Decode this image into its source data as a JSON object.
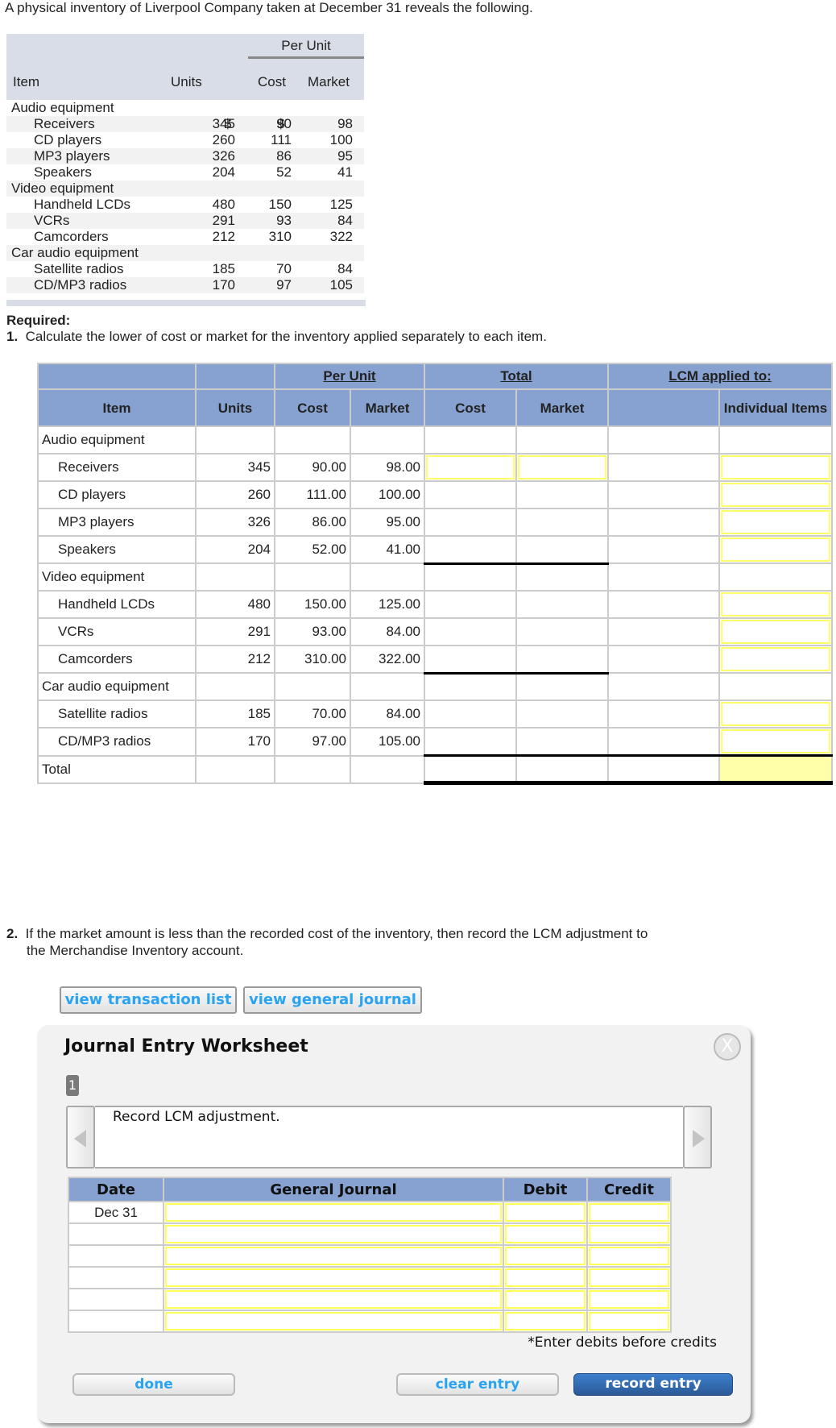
{
  "intro": "A physical inventory of Liverpool Company taken at December 31 reveals the following.",
  "source_table": {
    "group_header": "Per Unit",
    "headers": {
      "item": "Item",
      "units": "Units",
      "cost": "Cost",
      "market": "Market"
    },
    "rows": [
      {
        "type": "group",
        "item": "Audio equipment"
      },
      {
        "type": "item",
        "item": "Receivers",
        "units": "345",
        "cost": "90",
        "market": "98",
        "dollar": "$"
      },
      {
        "type": "item",
        "item": "CD players",
        "units": "260",
        "cost": "111",
        "market": "100"
      },
      {
        "type": "item",
        "item": "MP3 players",
        "units": "326",
        "cost": "86",
        "market": "95"
      },
      {
        "type": "item",
        "item": "Speakers",
        "units": "204",
        "cost": "52",
        "market": "41"
      },
      {
        "type": "group",
        "item": "Video equipment"
      },
      {
        "type": "item",
        "item": "Handheld LCDs",
        "units": "480",
        "cost": "150",
        "market": "125"
      },
      {
        "type": "item",
        "item": "VCRs",
        "units": "291",
        "cost": "93",
        "market": "84"
      },
      {
        "type": "item",
        "item": "Camcorders",
        "units": "212",
        "cost": "310",
        "market": "322"
      },
      {
        "type": "group",
        "item": "Car audio equipment"
      },
      {
        "type": "item",
        "item": "Satellite radios",
        "units": "185",
        "cost": "70",
        "market": "84"
      },
      {
        "type": "item",
        "item": "CD/MP3 radios",
        "units": "170",
        "cost": "97",
        "market": "105"
      }
    ]
  },
  "required": {
    "title": "Required:",
    "q1_num": "1.",
    "q1_text": "Calculate the lower of cost or market for the inventory applied separately to each item.",
    "q2_num": "2.",
    "q2_line1": "If the market amount is less than the recorded cost of the inventory, then record the LCM adjustment to",
    "q2_line2": "the Merchandise Inventory account."
  },
  "lcm_table": {
    "group_headers": {
      "per_unit": "Per Unit",
      "total": "Total",
      "lcm": "LCM applied to:"
    },
    "col_headers": {
      "item": "Item",
      "units": "Units",
      "cost": "Cost",
      "market": "Market",
      "total_cost": "Cost",
      "total_market": "Market",
      "lcm_blank": "",
      "individual": "Individual Items"
    },
    "rows": [
      {
        "type": "group",
        "item": "Audio equipment"
      },
      {
        "type": "item",
        "item": "Receivers",
        "units": "345",
        "cost": "90.00",
        "market": "98.00"
      },
      {
        "type": "item",
        "item": "CD players",
        "units": "260",
        "cost": "111.00",
        "market": "100.00"
      },
      {
        "type": "item",
        "item": "MP3 players",
        "units": "326",
        "cost": "86.00",
        "market": "95.00"
      },
      {
        "type": "item",
        "item": "Speakers",
        "units": "204",
        "cost": "52.00",
        "market": "41.00"
      },
      {
        "type": "group",
        "item": "Video equipment"
      },
      {
        "type": "item",
        "item": "Handheld LCDs",
        "units": "480",
        "cost": "150.00",
        "market": "125.00"
      },
      {
        "type": "item",
        "item": "VCRs",
        "units": "291",
        "cost": "93.00",
        "market": "84.00"
      },
      {
        "type": "item",
        "item": "Camcorders",
        "units": "212",
        "cost": "310.00",
        "market": "322.00"
      },
      {
        "type": "group",
        "item": "Car audio equipment"
      },
      {
        "type": "item",
        "item": "Satellite radios",
        "units": "185",
        "cost": "70.00",
        "market": "84.00"
      },
      {
        "type": "item",
        "item": "CD/MP3 radios",
        "units": "170",
        "cost": "97.00",
        "market": "105.00"
      },
      {
        "type": "total",
        "item": "Total"
      }
    ]
  },
  "buttons": {
    "view_transaction_list": "view transaction list",
    "view_general_journal": "view general journal"
  },
  "worksheet": {
    "title": "Journal Entry Worksheet",
    "close_symbol": "X",
    "page_number": "1",
    "description": "Record LCM adjustment.",
    "headers": {
      "date": "Date",
      "general_journal": "General Journal",
      "debit": "Debit",
      "credit": "Credit"
    },
    "rows": [
      {
        "date": "Dec 31"
      },
      {
        "date": ""
      },
      {
        "date": ""
      },
      {
        "date": ""
      },
      {
        "date": ""
      },
      {
        "date": ""
      }
    ],
    "note": "*Enter debits before credits",
    "done_label": "done",
    "clear_label": "clear entry",
    "record_label": "record entry"
  }
}
